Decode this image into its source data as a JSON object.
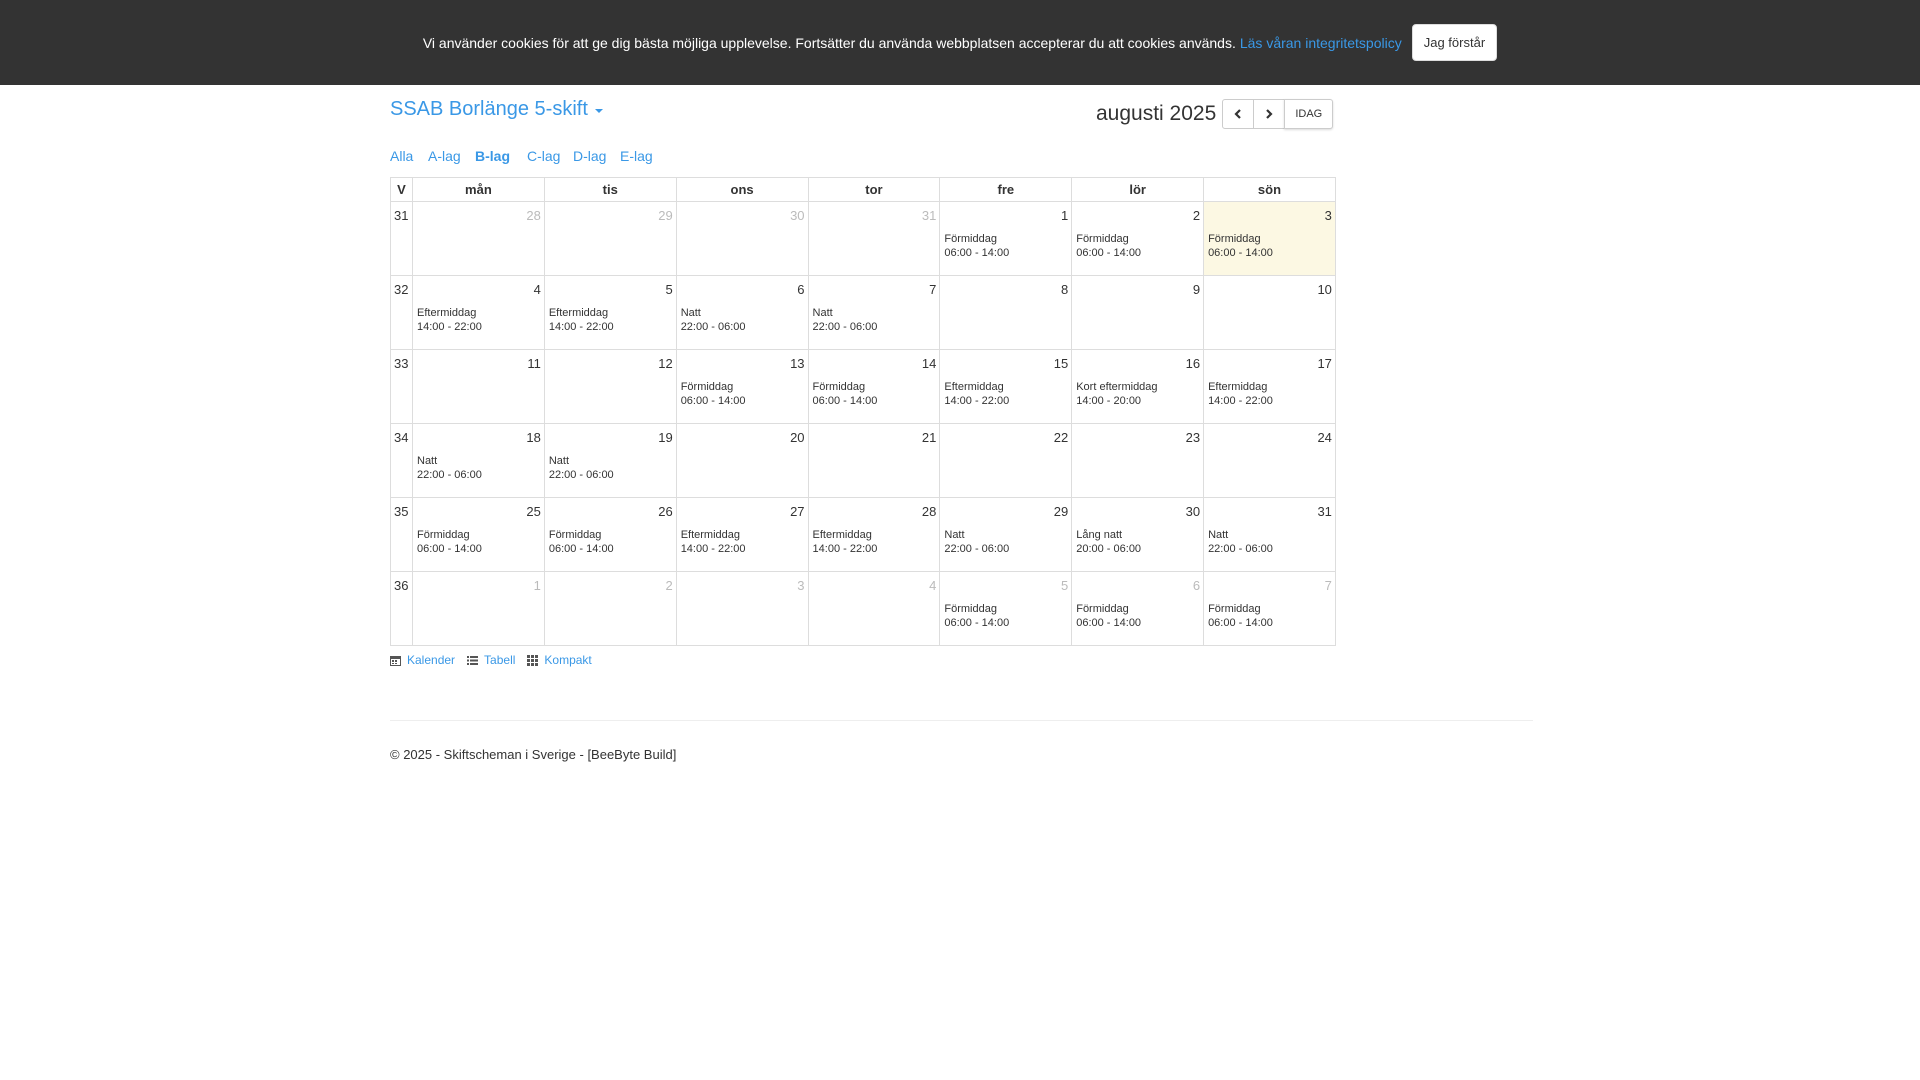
{
  "cookie": {
    "text": "Vi använder cookies för att ge dig bästa möjliga upplevelse. Fortsätter du använda webbplatsen accepterar du att cookies används.",
    "link": "Läs våran integritetspolicy",
    "button": "Jag förstår"
  },
  "header": {
    "title": "SSAB Borlänge 5-skift",
    "month": "augusti 2025",
    "today_label": "IDAG"
  },
  "teams": [
    {
      "label": "Alla",
      "active": false
    },
    {
      "label": "A-lag",
      "active": false
    },
    {
      "label": "B-lag",
      "active": true
    },
    {
      "label": "C-lag",
      "active": false
    },
    {
      "label": "D-lag",
      "active": false
    },
    {
      "label": "E-lag",
      "active": false
    }
  ],
  "calendar": {
    "headers": [
      "V",
      "mån",
      "tis",
      "ons",
      "tor",
      "fre",
      "lör",
      "sön"
    ],
    "weeks": [
      {
        "week": "31",
        "days": [
          {
            "day": "28",
            "other": true
          },
          {
            "day": "29",
            "other": true
          },
          {
            "day": "30",
            "other": true
          },
          {
            "day": "31",
            "other": true
          },
          {
            "day": "1",
            "shift": "Förmiddag",
            "time": "06:00 - 14:00"
          },
          {
            "day": "2",
            "shift": "Förmiddag",
            "time": "06:00 - 14:00"
          },
          {
            "day": "3",
            "shift": "Förmiddag",
            "time": "06:00 - 14:00",
            "today": true
          }
        ]
      },
      {
        "week": "32",
        "days": [
          {
            "day": "4",
            "shift": "Eftermiddag",
            "time": "14:00 - 22:00"
          },
          {
            "day": "5",
            "shift": "Eftermiddag",
            "time": "14:00 - 22:00"
          },
          {
            "day": "6",
            "shift": "Natt",
            "time": "22:00 - 06:00"
          },
          {
            "day": "7",
            "shift": "Natt",
            "time": "22:00 - 06:00"
          },
          {
            "day": "8"
          },
          {
            "day": "9"
          },
          {
            "day": "10"
          }
        ]
      },
      {
        "week": "33",
        "days": [
          {
            "day": "11"
          },
          {
            "day": "12"
          },
          {
            "day": "13",
            "shift": "Förmiddag",
            "time": "06:00 - 14:00"
          },
          {
            "day": "14",
            "shift": "Förmiddag",
            "time": "06:00 - 14:00"
          },
          {
            "day": "15",
            "shift": "Eftermiddag",
            "time": "14:00 - 22:00"
          },
          {
            "day": "16",
            "shift": "Kort eftermiddag",
            "time": "14:00 - 20:00"
          },
          {
            "day": "17",
            "shift": "Eftermiddag",
            "time": "14:00 - 22:00"
          }
        ]
      },
      {
        "week": "34",
        "days": [
          {
            "day": "18",
            "shift": "Natt",
            "time": "22:00 - 06:00"
          },
          {
            "day": "19",
            "shift": "Natt",
            "time": "22:00 - 06:00"
          },
          {
            "day": "20"
          },
          {
            "day": "21"
          },
          {
            "day": "22"
          },
          {
            "day": "23"
          },
          {
            "day": "24"
          }
        ]
      },
      {
        "week": "35",
        "days": [
          {
            "day": "25",
            "shift": "Förmiddag",
            "time": "06:00 - 14:00"
          },
          {
            "day": "26",
            "shift": "Förmiddag",
            "time": "06:00 - 14:00"
          },
          {
            "day": "27",
            "shift": "Eftermiddag",
            "time": "14:00 - 22:00"
          },
          {
            "day": "28",
            "shift": "Eftermiddag",
            "time": "14:00 - 22:00"
          },
          {
            "day": "29",
            "shift": "Natt",
            "time": "22:00 - 06:00"
          },
          {
            "day": "30",
            "shift": "Lång natt",
            "time": "20:00 - 06:00"
          },
          {
            "day": "31",
            "shift": "Natt",
            "time": "22:00 - 06:00"
          }
        ]
      },
      {
        "week": "36",
        "days": [
          {
            "day": "1",
            "other": true
          },
          {
            "day": "2",
            "other": true
          },
          {
            "day": "3",
            "other": true
          },
          {
            "day": "4",
            "other": true
          },
          {
            "day": "5",
            "other": true,
            "shift": "Förmiddag",
            "time": "06:00 - 14:00"
          },
          {
            "day": "6",
            "other": true,
            "shift": "Förmiddag",
            "time": "06:00 - 14:00"
          },
          {
            "day": "7",
            "other": true,
            "shift": "Förmiddag",
            "time": "06:00 - 14:00"
          }
        ]
      }
    ]
  },
  "views": [
    {
      "label": "Kalender",
      "icon": "calendar-icon"
    },
    {
      "label": "Tabell",
      "icon": "list-icon"
    },
    {
      "label": "Kompakt",
      "icon": "grid-icon"
    }
  ],
  "footer": "© 2025 - Skiftscheman i Sverige - [BeeByte Build]",
  "colors": {
    "accent": "#3a98e6",
    "cookie_bg": "#333333",
    "today_bg": "#fcf8e3"
  }
}
